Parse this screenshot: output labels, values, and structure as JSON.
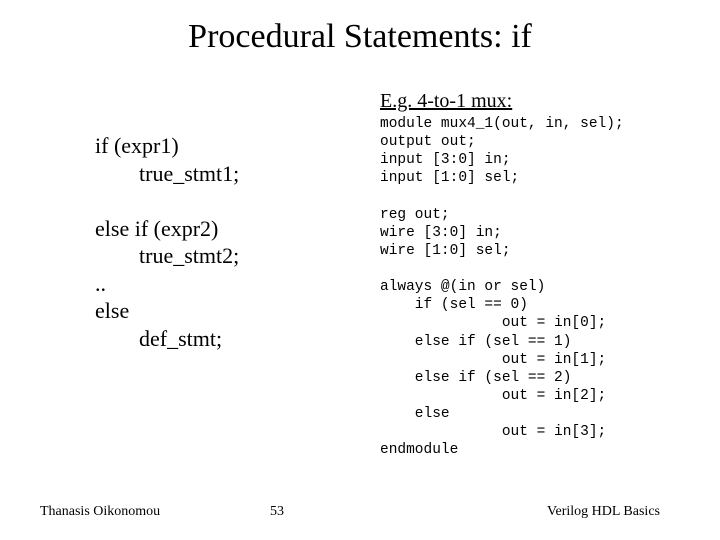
{
  "title": "Procedural Statements: if",
  "subhead": "E.g. 4-to-1 mux:",
  "left_code": "if (expr1)\n        true_stmt1;\n\nelse if (expr2)\n        true_stmt2;\n..\nelse\n        def_stmt;",
  "right_code": "module mux4_1(out, in, sel);\noutput out;\ninput [3:0] in;\ninput [1:0] sel;\n\nreg out;\nwire [3:0] in;\nwire [1:0] sel;\n\nalways @(in or sel)\n    if (sel == 0)\n              out = in[0];\n    else if (sel == 1)\n              out = in[1];\n    else if (sel == 2)\n              out = in[2];\n    else\n              out = in[3];\nendmodule",
  "footer_left": "Thanasis Oikonomou",
  "page_number": "53",
  "footer_right": "Verilog HDL Basics"
}
